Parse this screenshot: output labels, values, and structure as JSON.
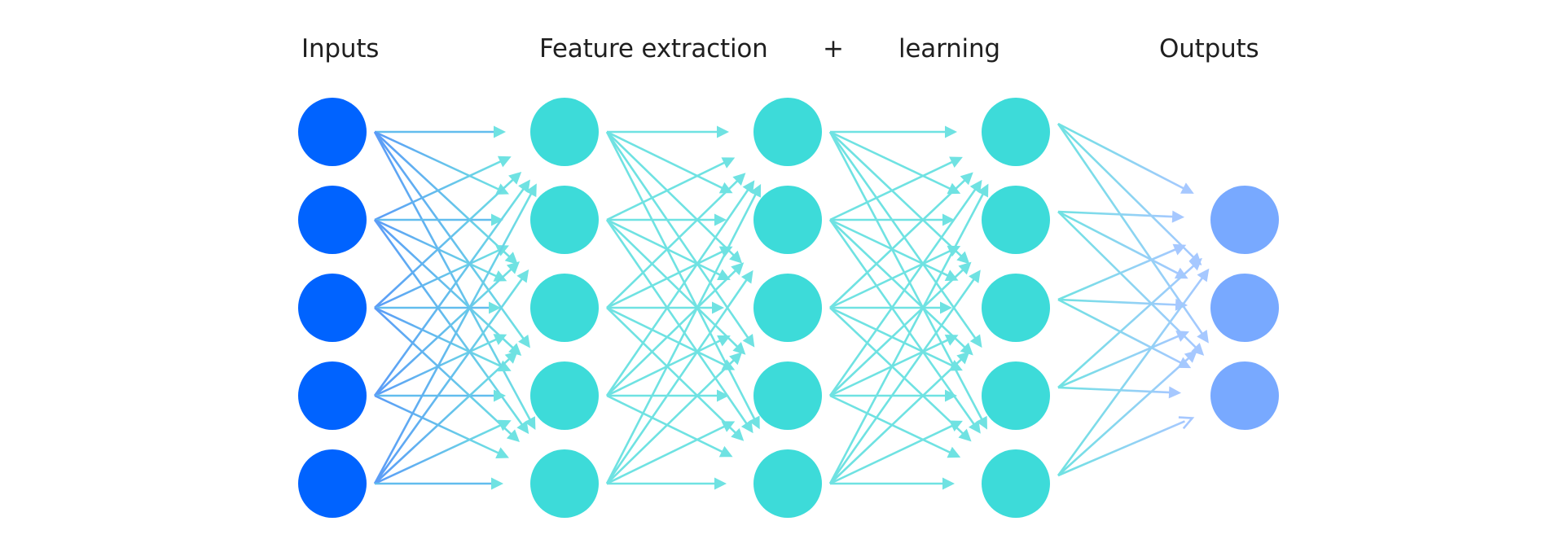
{
  "labels": {
    "inputs": "Inputs",
    "feature_extraction": "Feature extraction",
    "plus": "+",
    "learning": "learning",
    "outputs": "Outputs"
  },
  "network": {
    "layers": [
      {
        "name": "input",
        "nodes": 5,
        "color": "#0063ff"
      },
      {
        "name": "hidden-1",
        "nodes": 5,
        "color": "#3ddbd9"
      },
      {
        "name": "hidden-2",
        "nodes": 5,
        "color": "#3ddbd9"
      },
      {
        "name": "hidden-3",
        "nodes": 5,
        "color": "#3ddbd9"
      },
      {
        "name": "output",
        "nodes": 3,
        "color": "#78a9ff"
      }
    ],
    "connections": "fully-connected",
    "edge_colors": {
      "input_start": "#5b9bf7",
      "hidden": "#6fe2e2",
      "output_end": "#a6c8ff"
    }
  }
}
